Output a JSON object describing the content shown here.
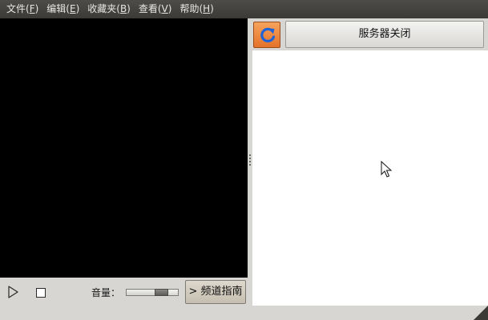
{
  "menubar": {
    "items": [
      {
        "label": "文件(",
        "mnemonic": "F",
        "suffix": ")"
      },
      {
        "label": "编辑(",
        "mnemonic": "E",
        "suffix": ")"
      },
      {
        "label": "收藏夹(",
        "mnemonic": "B",
        "suffix": ")"
      },
      {
        "label": "查看(",
        "mnemonic": "V",
        "suffix": ")"
      },
      {
        "label": "帮助(",
        "mnemonic": "H",
        "suffix": ")"
      }
    ]
  },
  "controls": {
    "play_icon": "play-icon",
    "stop_icon": "stop-icon",
    "volume_label": "音量：",
    "volume_level": 0.74,
    "guide_button": "> 频道指南"
  },
  "right_panel": {
    "refresh_icon": "refresh-icon",
    "server_button": "服务器关闭"
  },
  "colors": {
    "menubar": "#3b3a37",
    "video_background": "#000000",
    "accent": "#e5722a",
    "refresh_arrow": "#1f63d6"
  }
}
